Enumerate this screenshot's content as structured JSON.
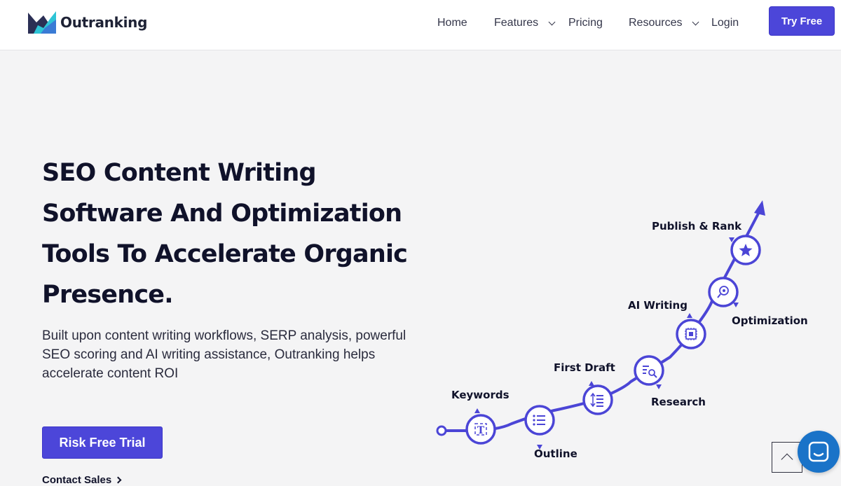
{
  "brand": {
    "name": "Outranking"
  },
  "nav": {
    "home": "Home",
    "features": "Features",
    "pricing": "Pricing",
    "resources": "Resources",
    "login": "Login",
    "try_free": "Try Free"
  },
  "hero": {
    "title": "SEO Content Writing Software And Optimization Tools To Accelerate Organic Presence.",
    "description": "Built upon content writing workflows, SERP analysis, powerful SEO scoring and AI writing assistance, Outranking helps accelerate content ROI",
    "cta": "Risk Free Trial",
    "contact": "Contact Sales"
  },
  "workflow": {
    "steps": [
      {
        "label": "Keywords",
        "icon": "text-icon"
      },
      {
        "label": "Outline",
        "icon": "list-icon"
      },
      {
        "label": "First Draft",
        "icon": "draft-icon"
      },
      {
        "label": "Research",
        "icon": "search-doc-icon"
      },
      {
        "label": "AI Writing",
        "icon": "chip-icon"
      },
      {
        "label": "Optimization",
        "icon": "gear-search-icon"
      },
      {
        "label": "Publish & Rank",
        "icon": "star-icon"
      }
    ]
  },
  "widgets": {
    "scroll_top_icon": "chevron-up-icon",
    "chat_icon": "chat-icon"
  },
  "colors": {
    "accent": "#4c46d9",
    "path": "#4b45d6",
    "chat": "#1a73c8"
  }
}
